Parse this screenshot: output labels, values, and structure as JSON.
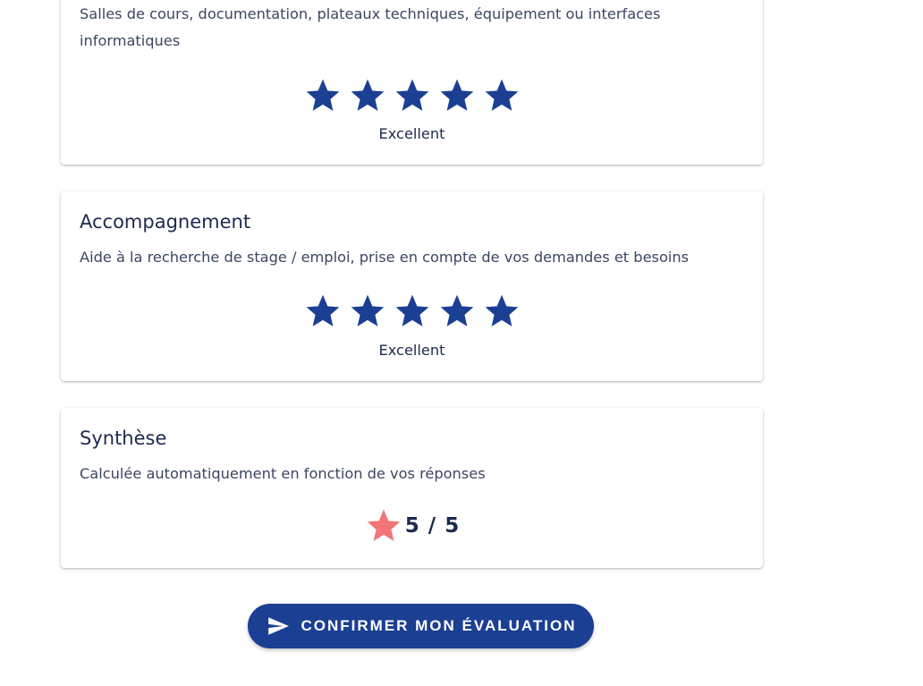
{
  "colors": {
    "star_filled": "#1b3f93",
    "summary_star": "#f37576",
    "button_bg": "#1b3f93"
  },
  "cards": {
    "infrastructure": {
      "description": "Salles de cours, documentation, plateaux techniques, équipement ou interfaces informatiques",
      "rating": 5,
      "rating_max": 5,
      "rating_label": "Excellent"
    },
    "accompagnement": {
      "title": "Accompagnement",
      "description": "Aide à la recherche de stage / emploi, prise en compte de vos demandes et besoins",
      "rating": 5,
      "rating_max": 5,
      "rating_label": "Excellent"
    },
    "synthese": {
      "title": "Synthèse",
      "description": "Calculée automatiquement en fonction de vos réponses",
      "score_text": "5 / 5",
      "icon": "star-icon"
    }
  },
  "confirm_button": {
    "label": "CONFIRMER MON ÉVALUATION",
    "icon": "send-icon"
  }
}
